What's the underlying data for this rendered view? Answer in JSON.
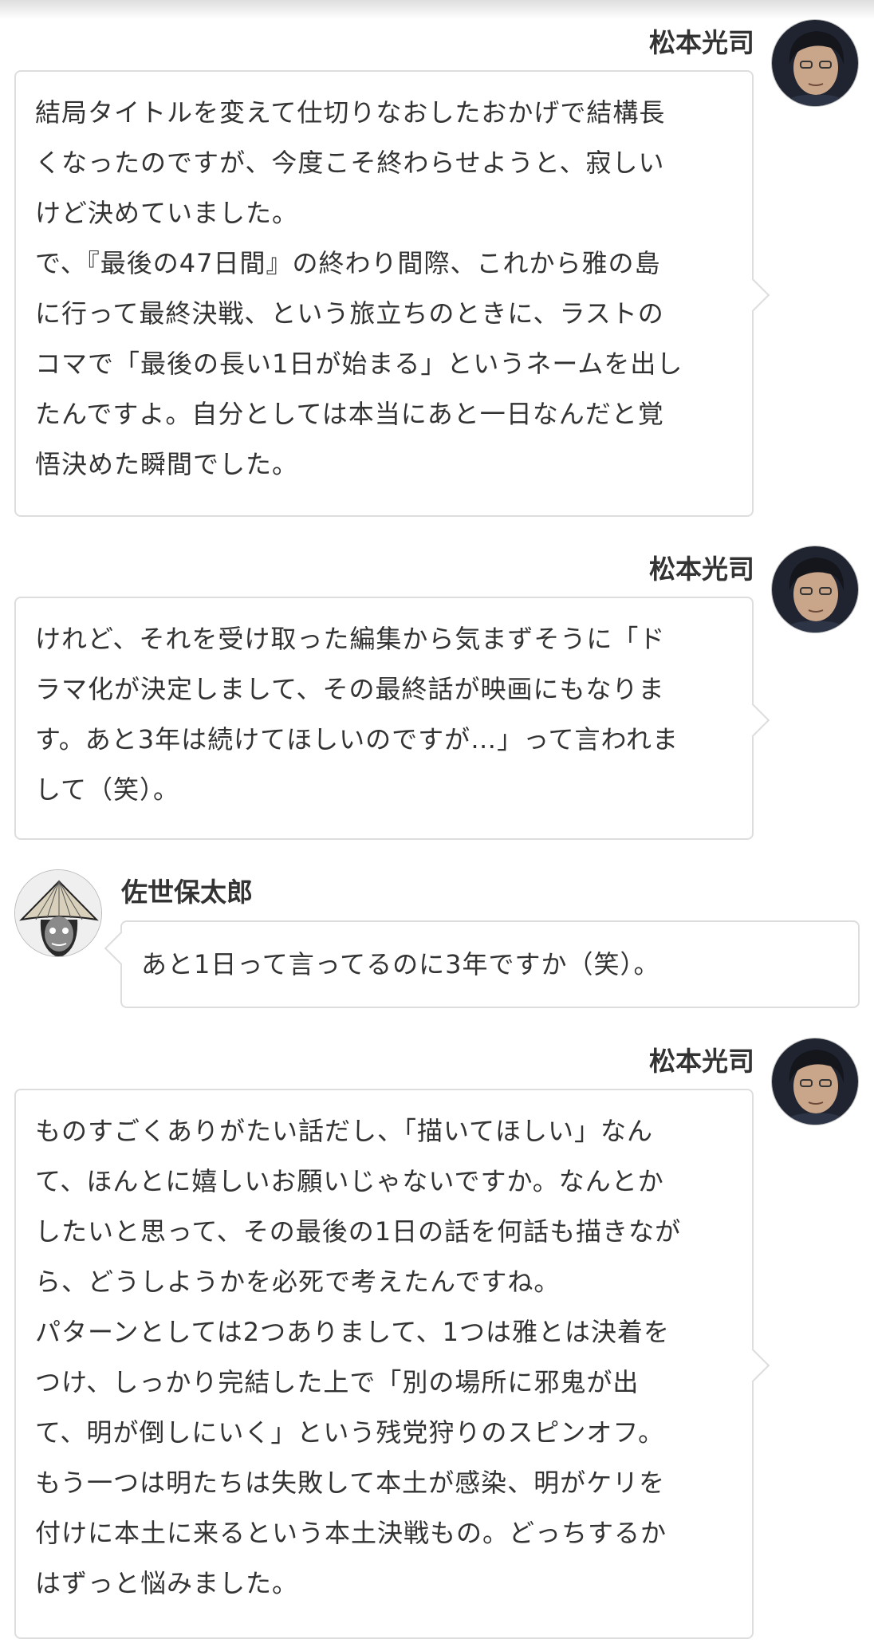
{
  "messages": [
    {
      "speaker": "松本光司",
      "avatar_icon": "matsumoto-avatar",
      "lines": [
        "結局タイトルを変えて仕切りなおしたおかげで結構長",
        "くなったのですが、今度こそ終わらせようと、寂しい",
        "けど決めていました。",
        "で、『最後の47日間』の終わり間際、これから雅の島",
        "に行って最終決戦、という旅立ちのときに、ラストの",
        "コマで「最後の長い1日が始まる」というネームを出し",
        "たんですよ。自分としては本当にあと一日なんだと覚",
        "悟決めた瞬間でした。"
      ]
    },
    {
      "speaker": "松本光司",
      "avatar_icon": "matsumoto-avatar",
      "lines": [
        "けれど、それを受け取った編集から気まずそうに「ド",
        "ラマ化が決定しまして、その最終話が映画にもなりま",
        "す。あと3年は続けてほしいのですが…」って言われま",
        "して（笑）。"
      ]
    },
    {
      "speaker": "佐世保太郎",
      "avatar_icon": "sasebo-avatar",
      "lines": [
        "あと1日って言ってるのに3年ですか（笑）。"
      ]
    },
    {
      "speaker": "松本光司",
      "avatar_icon": "matsumoto-avatar",
      "lines": [
        "ものすごくありがたい話だし、「描いてほしい」なん",
        "て、ほんとに嬉しいお願いじゃないですか。なんとか",
        "したいと思って、その最後の1日の話を何話も描きなが",
        "ら、どうしようかを必死で考えたんですね。",
        "パターンとしては2つありまして、1つは雅とは決着を",
        "つけ、しっかり完結した上で「別の場所に邪鬼が出",
        "て、明が倒しにいく」という残党狩りのスピンオフ。",
        "もう一つは明たちは失敗して本土が感染、明がケリを",
        "付けに本土に来るという本土決戦もの。どっちするか",
        "はずっと悩みました。"
      ]
    }
  ]
}
